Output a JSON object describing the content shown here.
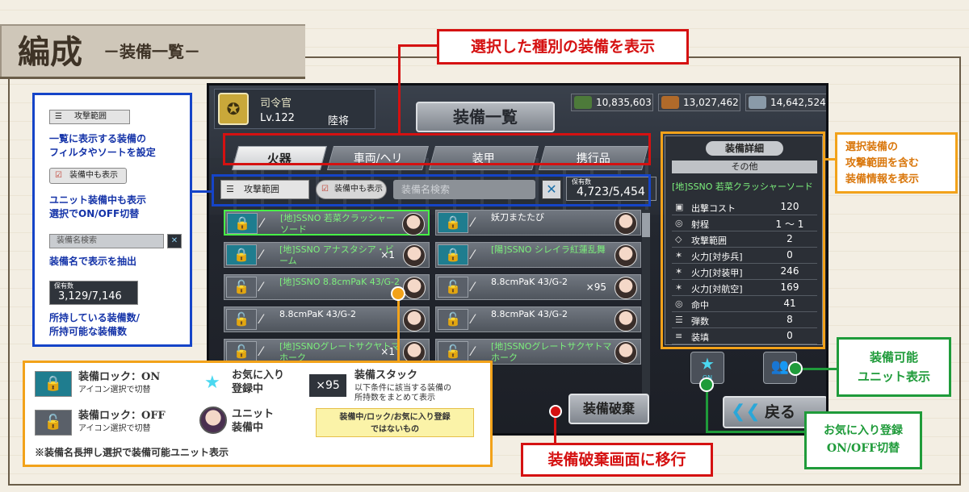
{
  "header": {
    "title": "編成",
    "subtitle": "－装備一覧－"
  },
  "game": {
    "commander": {
      "name": "司令官",
      "level": "Lv.122",
      "rank": "陸将"
    },
    "resources": [
      "10,835,603",
      "13,027,462",
      "14,642,524"
    ],
    "screen_title": "装備一覧",
    "tabs": [
      "火器",
      "車両/ヘリ",
      "装甲",
      "携行品"
    ],
    "filter": {
      "range_label": "攻撃範囲",
      "equipped_label": "装備中も表示",
      "search_placeholder": "装備名検索",
      "count_label": "保有数",
      "count_value": "4,723/5,454"
    },
    "items": [
      {
        "name": "[地]SSNO 若菜クラッシャーソード",
        "lock": "on",
        "fav": true,
        "stack": ""
      },
      {
        "name": "妖刀またたび",
        "lock": "on",
        "fav": false,
        "stack": ""
      },
      {
        "name": "[地]SSNO アナスタシア・ビーム",
        "lock": "on",
        "fav": true,
        "stack": "×1"
      },
      {
        "name": "[陽]SSNO シレイラ紅蓮乱舞",
        "lock": "on",
        "fav": true,
        "stack": ""
      },
      {
        "name": "[地]SSNO 8.8cmPaK 43/G-2",
        "lock": "off",
        "fav": true,
        "stack": ""
      },
      {
        "name": "8.8cmPaK 43/G-2",
        "lock": "off",
        "fav": false,
        "stack": "×95"
      },
      {
        "name": "8.8cmPaK 43/G-2",
        "lock": "off",
        "fav": false,
        "stack": ""
      },
      {
        "name": "8.8cmPaK 43/G-2",
        "lock": "off",
        "fav": false,
        "stack": ""
      },
      {
        "name": "[地]SSNOグレートサクヤトマホーク",
        "lock": "off",
        "fav": true,
        "stack": "×1"
      },
      {
        "name": "[地]SSNOグレートサクヤトマホーク",
        "lock": "off",
        "fav": true,
        "stack": ""
      }
    ],
    "detail": {
      "title": "装備詳細",
      "category": "その他",
      "name": "[地]SSNO 若菜クラッシャーソード",
      "stats": [
        {
          "k": "出撃コスト",
          "v": "120"
        },
        {
          "k": "射程",
          "v": "1 ～ 1"
        },
        {
          "k": "攻撃範囲",
          "v": "2"
        },
        {
          "k": "火力[対歩兵]",
          "v": "0"
        },
        {
          "k": "火力[対装甲]",
          "v": "246"
        },
        {
          "k": "火力[対航空]",
          "v": "169"
        },
        {
          "k": "命中",
          "v": "41"
        },
        {
          "k": "弾数",
          "v": "8"
        },
        {
          "k": "装填",
          "v": "0"
        }
      ]
    },
    "fav_button_label": "ON",
    "back_label": "戻る",
    "scrap_label": "装備破棄"
  },
  "callouts": {
    "top_red": "選択した種別の装備を表示",
    "bottom_red": "装備破棄画面に移行",
    "right_orange": "選択装備の\n攻撃範囲を含む\n装備情報を表示",
    "green_unit": "装備可能\nユニット表示",
    "green_fav": "お気に入り登録\nON/OFF切替"
  },
  "blue_panel": {
    "range_label": "攻撃範囲",
    "range_desc_1": "一覧に表示する装備の",
    "range_desc_2": "フィルタやソートを設定",
    "equipped_label": "装備中も表示",
    "equipped_desc_1": "ユニット装備中も表示",
    "equipped_desc_2": "選択でON/OFF切替",
    "search_placeholder": "装備名検索",
    "search_desc": "装備名で表示を抽出",
    "count_label": "保有数",
    "count_value": "3,129/7,146",
    "count_desc_1": "所持している装備数/",
    "count_desc_2": "所持可能な装備数"
  },
  "legend": {
    "lock_on": "装備ロック：ON",
    "lock_on_sub": "アイコン選択で切替",
    "lock_off": "装備ロック：OFF",
    "lock_off_sub": "アイコン選択で切替",
    "fav": "お気に入り",
    "fav_2": "登録中",
    "unit": "ユニット",
    "unit_2": "装備中",
    "stack_icon": "×95",
    "stack": "装備スタック",
    "stack_desc_1": "以下条件に該当する装備の",
    "stack_desc_2": "所持数をまとめて表示",
    "cond_1": "装備中/ロック/お気に入り登録",
    "cond_2": "ではないもの",
    "note": "※装備名長押し選択で装備可能ユニット表示"
  },
  "colors": {
    "red": "#d51111",
    "blue": "#1544c8",
    "orange": "#f2a21a",
    "green": "#1f9b3a",
    "favorite_green": "#7cf07c"
  }
}
